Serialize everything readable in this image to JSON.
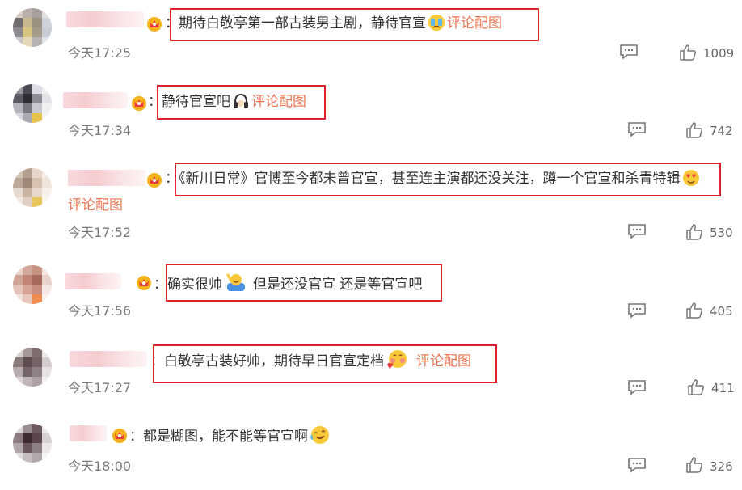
{
  "comments": [
    {
      "text": "：期待白敬亭第一部古装男主剧，静待官宣",
      "link": "评论配图",
      "time": "今天17:25",
      "likes": "1009"
    },
    {
      "text": "：静待官宣吧",
      "link": "评论配图",
      "time": "今天17:34",
      "likes": "742"
    },
    {
      "text": "：《新川日常》官博至今都未曾官宣，甚至连主演都还没关注，蹲一个官宣和杀青特辑",
      "link": "评论配图",
      "time": "今天17:52",
      "likes": "530"
    },
    {
      "text": "：确实很帅",
      "text2": "但是还没官宣 还是等官宣吧",
      "time": "今天17:56",
      "likes": "405"
    },
    {
      "text": "：白敬亭古装好帅，期待早日官宣定档",
      "link": "评论配图",
      "time": "今天17:27",
      "likes": "411"
    },
    {
      "text": "：都是糊图，能不能等官宣啊",
      "time": "今天18:00",
      "likes": "326"
    }
  ],
  "colors": {
    "link": "#eb7350",
    "highlight": "#e0202a",
    "time": "#7a7a7a"
  }
}
